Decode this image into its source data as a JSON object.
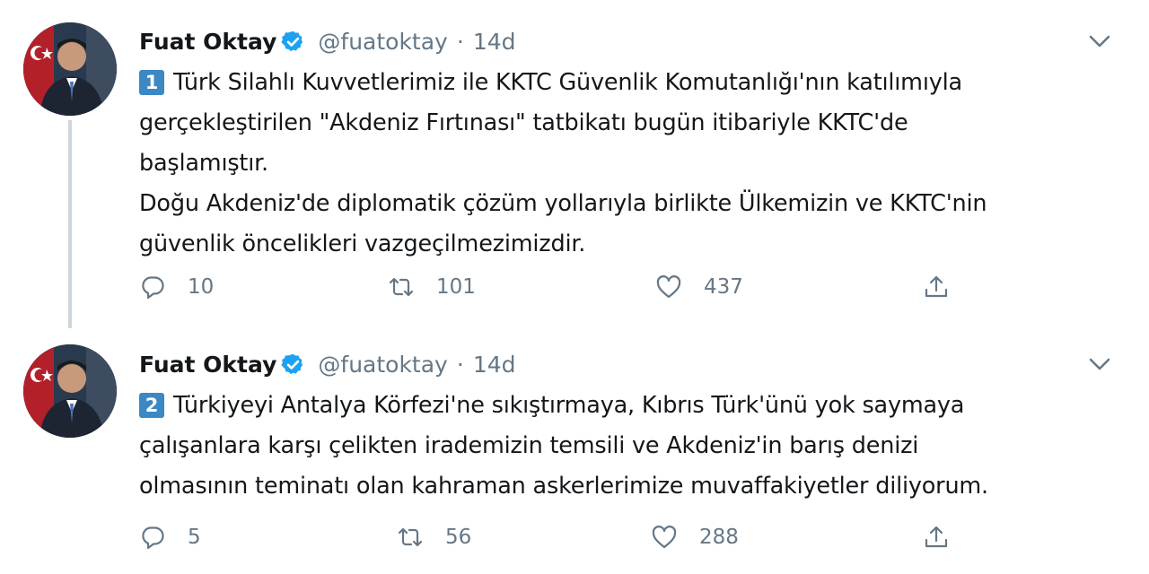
{
  "colors": {
    "text": "#14171a",
    "secondary": "#657786",
    "verified": "#1da1f2",
    "number_badge": "#3b88c3",
    "thread_line": "#ccd6dd"
  },
  "tweets": [
    {
      "author": {
        "name": "Fuat Oktay",
        "handle": "@fuatoktay",
        "verified": true
      },
      "separator": "·",
      "time": "14d",
      "number_badge": "1",
      "lines": [
        "Türk Silahlı Kuvvetlerimiz ile KKTC Güvenlik Komutanlığı'nın katılımıyla",
        "gerçekleştirilen \"Akdeniz Fırtınası\" tatbikatı bugün itibariyle KKTC'de",
        "başlamıştır.",
        "Doğu Akdeniz'de diplomatik çözüm yollarıyla birlikte Ülkemizin ve KKTC'nin",
        "güvenlik öncelikleri vazgeçilmezimizdir."
      ],
      "actions": {
        "reply_count": "10",
        "retweet_count": "101",
        "like_count": "437"
      },
      "icons": [
        "avatar",
        "verified-icon",
        "chevron-down-icon",
        "reply-icon",
        "retweet-icon",
        "like-icon",
        "share-icon"
      ]
    },
    {
      "author": {
        "name": "Fuat Oktay",
        "handle": "@fuatoktay",
        "verified": true
      },
      "separator": "·",
      "time": "14d",
      "number_badge": "2",
      "lines": [
        "Türkiyeyi Antalya Körfezi'ne sıkıştırmaya, Kıbrıs Türk'ünü yok saymaya",
        "çalışanlara karşı çelikten irademizin temsili ve Akdeniz'in barış denizi",
        "olmasının teminatı olan kahraman askerlerimize muvaffakiyetler diliyorum."
      ],
      "actions": {
        "reply_count": "5",
        "retweet_count": "56",
        "like_count": "288"
      },
      "icons": [
        "avatar",
        "verified-icon",
        "chevron-down-icon",
        "reply-icon",
        "retweet-icon",
        "like-icon",
        "share-icon"
      ]
    }
  ]
}
